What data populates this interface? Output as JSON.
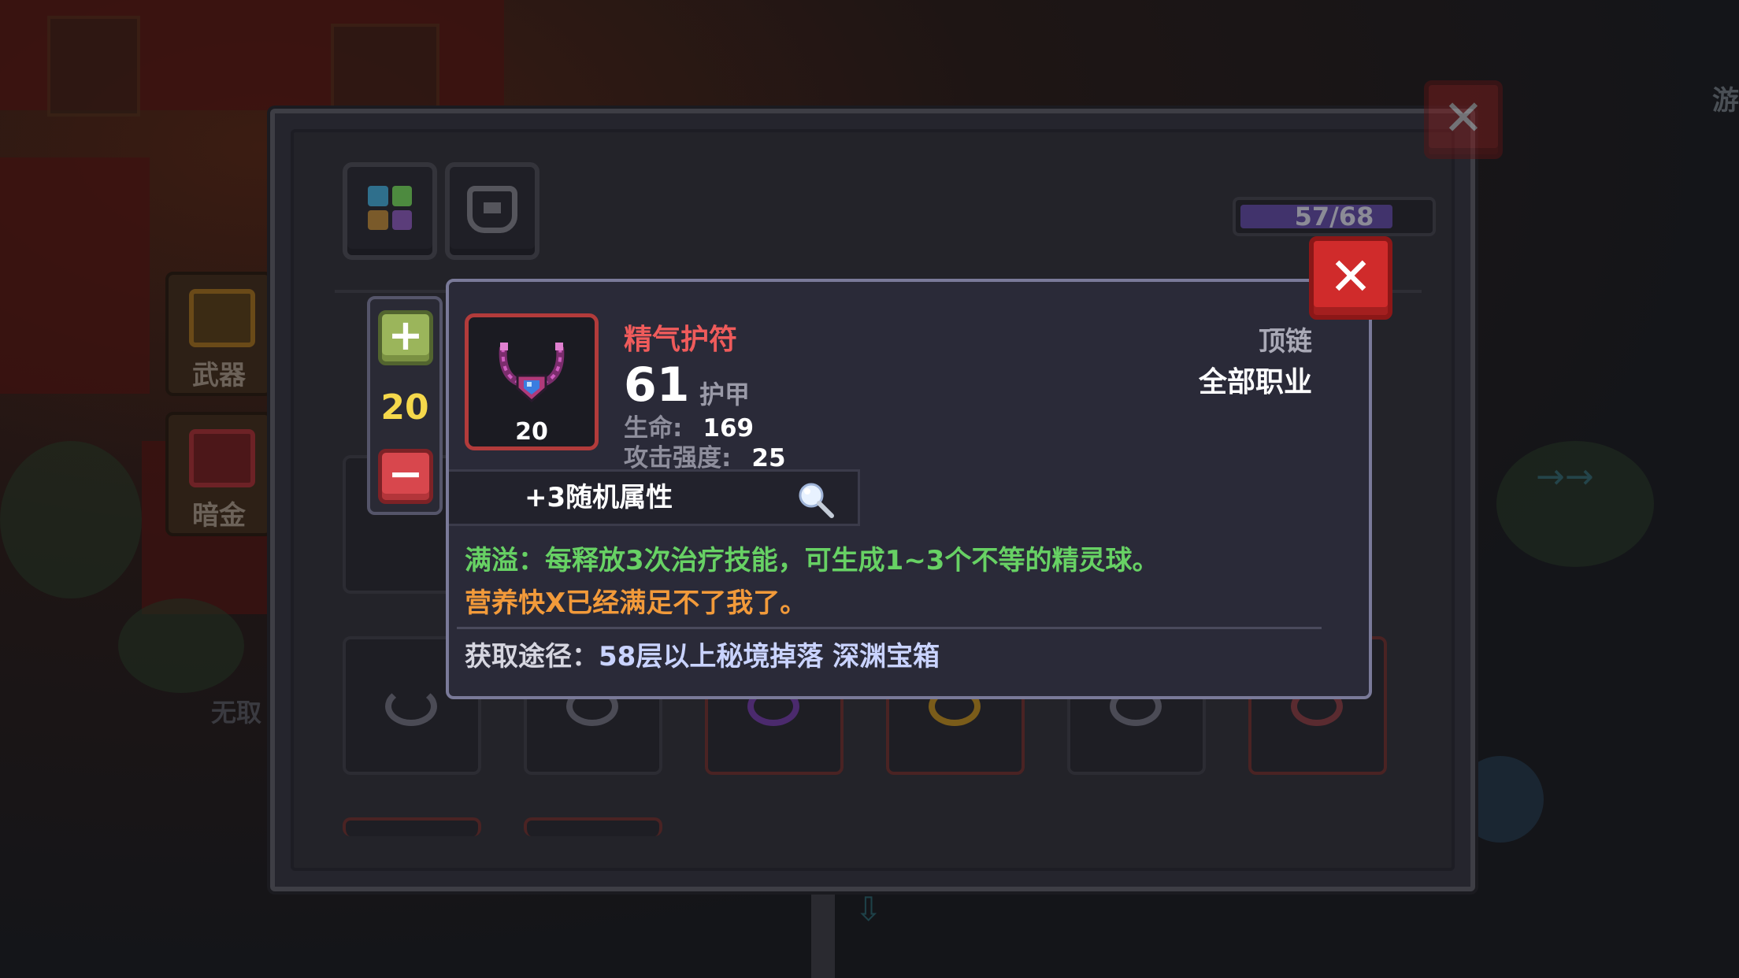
{
  "background": {
    "side_menu": [
      {
        "label": "武器"
      },
      {
        "label": "暗金"
      }
    ],
    "side_menu_partial_label": "无取",
    "corner_text": "游"
  },
  "inventory": {
    "tabs": [
      {
        "icon": "grid-icon",
        "active": true
      },
      {
        "icon": "armor-icon",
        "active": false
      }
    ],
    "capacity": {
      "text": "57/68",
      "current": 57,
      "max": 68
    },
    "close_icon": "close-icon"
  },
  "stepper": {
    "quantity": "20",
    "plus_label": "+",
    "minus_label": "−"
  },
  "tooltip": {
    "item_name": "精气护符",
    "item_level": "20",
    "armor_value": "61",
    "armor_label": "护甲",
    "stats": [
      {
        "label": "生命:",
        "value": "169"
      },
      {
        "label": "攻击强度:",
        "value": "25"
      }
    ],
    "slot_type": "顶链",
    "class_restriction": "全部职业",
    "random_attr": "+3随机属性",
    "effect": "满溢：每释放3次治疗技能，可生成1~3个不等的精灵球。",
    "flavor": "营养快X已经满足不了我了。",
    "source_label": "获取途径：",
    "source_value": "58层以上秘境掉落 深渊宝箱",
    "colors": {
      "name": "#ef5b5b",
      "effect": "#67d164",
      "flavor": "#f29a3a",
      "quantity": "#f5d84b",
      "close": "#d02b2b"
    }
  }
}
